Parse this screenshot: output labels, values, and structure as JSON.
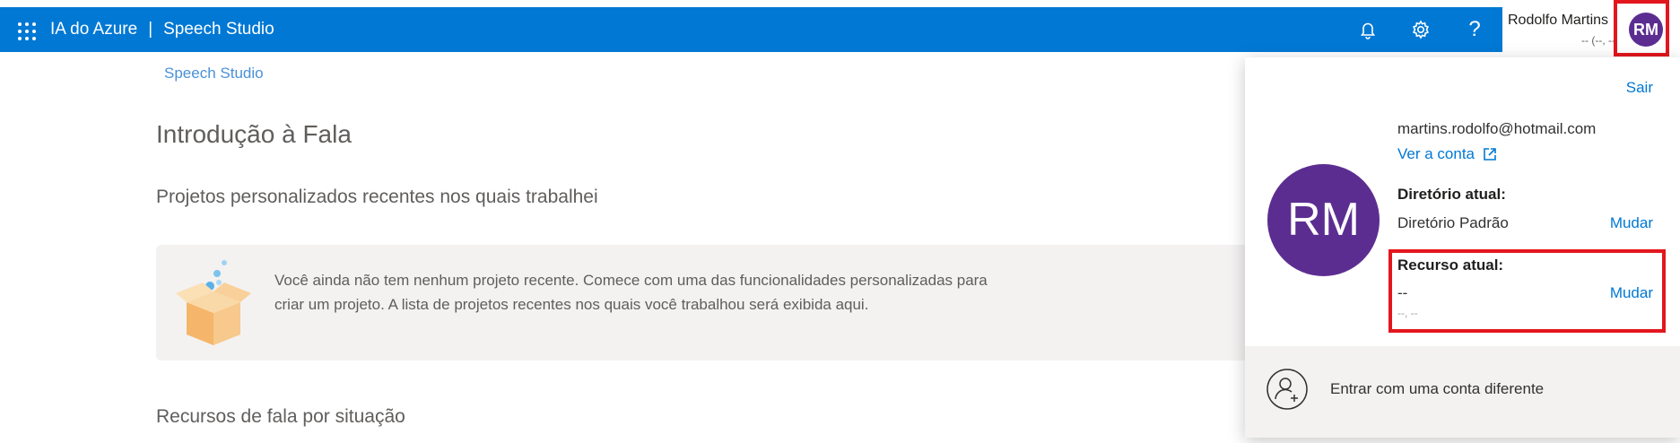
{
  "header": {
    "app_name": "IA do Azure",
    "separator": "|",
    "product_name": "Speech Studio",
    "icons": [
      "notifications-icon",
      "settings-icon",
      "help-icon"
    ],
    "help_glyph": "?",
    "user": {
      "name": "Rodolfo Martins",
      "subtitle": "-- (--, --",
      "initials": "RM"
    }
  },
  "breadcrumb": "Speech Studio",
  "page_title": "Introdução à Fala",
  "recent_projects": {
    "heading": "Projetos personalizados recentes nos quais trabalhei",
    "empty_message": "Você ainda não tem nenhum projeto recente. Comece com uma das funcionalidades personalizadas para criar um projeto. A lista de projetos recentes nos quais você trabalhou será exibida aqui."
  },
  "section_2_heading": "Recursos de fala por situação",
  "account_panel": {
    "sign_out": "Sair",
    "initials": "RM",
    "email": "martins.rodolfo@hotmail.com",
    "view_account": "Ver a conta",
    "directory_label": "Diretório atual:",
    "directory_value": "Diretório Padrão",
    "resource_label": "Recurso atual:",
    "resource_value": "--",
    "resource_sub": "--, --",
    "change_label": "Mudar",
    "other_account": "Entrar com uma conta diferente"
  },
  "colors": {
    "brand_blue": "#0078d4",
    "avatar_purple": "#5c2d91",
    "highlight_red": "#e3161e"
  }
}
